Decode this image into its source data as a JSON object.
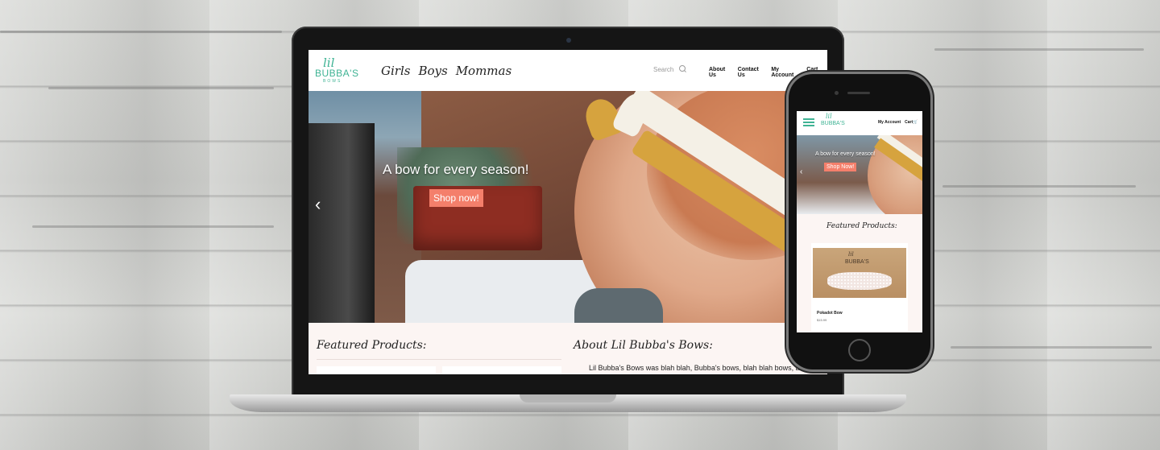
{
  "desktop": {
    "logo": {
      "lil": "lil",
      "name": "BUBBA'S",
      "sub": "BOWS"
    },
    "nav": [
      "Girls",
      "Boys",
      "Mommas"
    ],
    "search_placeholder": "Search",
    "top_links": [
      "About Us",
      "Contact Us",
      "My Account",
      "Cart"
    ],
    "hero": {
      "title": "A bow for every season!",
      "cta": "Shop now!"
    },
    "featured_title": "Featured Products:",
    "about_title": "About Lil Bubba's Bows:",
    "about_text": "Lil Bubba's Bows was blah blah, Bubba's bows, blah blah bows, and"
  },
  "mobile": {
    "logo": {
      "lil": "lil",
      "name": "BUBBA'S"
    },
    "top_links": [
      "My Account",
      "Cart"
    ],
    "hero": {
      "title": "A bow for every season!",
      "cta": "Shop Now!"
    },
    "featured_title": "Featured Products:",
    "product": {
      "brand": {
        "lil": "lil",
        "name": "BUBBA'S"
      },
      "name": "Pokadot Bow",
      "price": "$15.99"
    }
  },
  "colors": {
    "accent": "#3fb394",
    "cta": "#f47f6b",
    "panel": "#fcf5f3"
  }
}
